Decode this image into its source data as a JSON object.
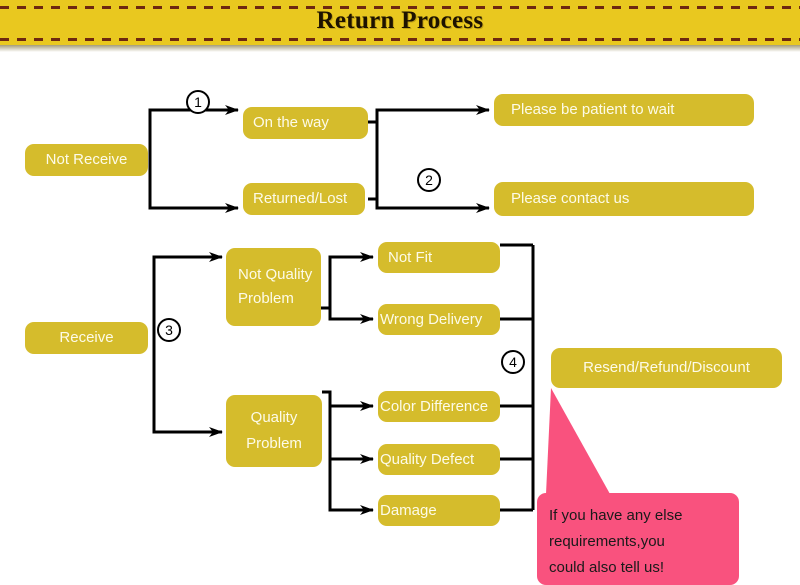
{
  "header": {
    "title": "Return Process",
    "banner_color": "#e9c81f",
    "dash_color": "#6d2710"
  },
  "theme": {
    "node_color": "#d5bc2c",
    "node_text_color": "#fdfbe8",
    "line_color": "#000000",
    "callout_color": "#f9527e"
  },
  "flow": {
    "roots": [
      {
        "id": "not-receive",
        "label": "Not Receive"
      },
      {
        "id": "receive",
        "label": "Receive"
      }
    ],
    "branch_not_receive": [
      {
        "id": "on-the-way",
        "label": "On the way"
      },
      {
        "id": "returned-lost",
        "label": "Returned/Lost"
      }
    ],
    "outcomes_not_receive": [
      {
        "id": "be-patient",
        "label": "Please be patient to wait"
      },
      {
        "id": "contact-us",
        "label": "Please contact us"
      }
    ],
    "branch_receive": [
      {
        "id": "not-quality-problem",
        "label": "Not Quality Problem"
      },
      {
        "id": "quality-problem",
        "label": "Quality Problem"
      }
    ],
    "reasons_not_quality": [
      {
        "id": "not-fit",
        "label": "Not Fit"
      },
      {
        "id": "wrong-delivery",
        "label": "Wrong Delivery"
      }
    ],
    "reasons_quality": [
      {
        "id": "color-difference",
        "label": "Color Difference"
      },
      {
        "id": "quality-defect",
        "label": "Quality Defect"
      },
      {
        "id": "damage",
        "label": "Damage"
      }
    ],
    "final_outcome": {
      "id": "resend-refund-discount",
      "label": "Resend/Refund/Discount"
    },
    "markers": [
      {
        "id": "marker-1",
        "label": "1"
      },
      {
        "id": "marker-2",
        "label": "2"
      },
      {
        "id": "marker-3",
        "label": "3"
      },
      {
        "id": "marker-4",
        "label": "4"
      }
    ]
  },
  "callout": {
    "line1": "If you have any else",
    "line2": "requirements,you",
    "line3": "could also tell us!"
  }
}
